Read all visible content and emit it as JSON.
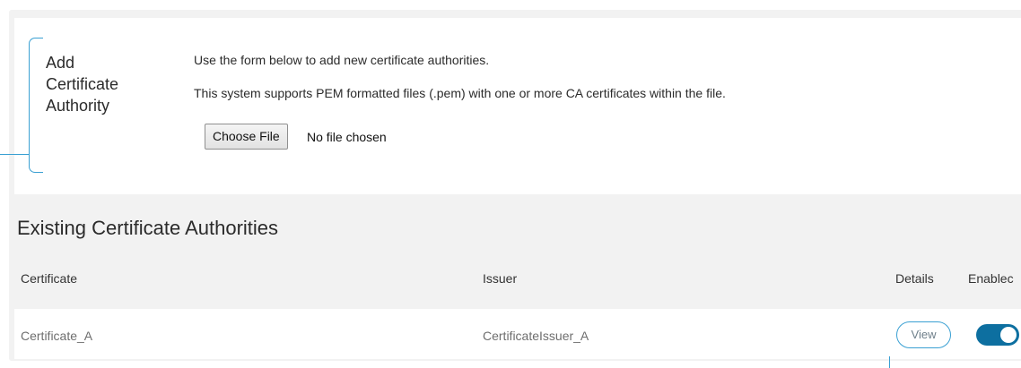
{
  "add_section": {
    "title_lines": [
      "Add",
      "Certificate",
      "Authority"
    ],
    "description": "Use the form below to add new certificate authorities.",
    "support_note": "This system supports PEM formatted files (.pem) with one or more CA certificates within the file.",
    "choose_file_label": "Choose File",
    "file_status": "No file chosen"
  },
  "existing_section": {
    "title": "Existing Certificate Authorities",
    "columns": {
      "certificate": "Certificate",
      "issuer": "Issuer",
      "details": "Details",
      "enabled": "Enablec"
    },
    "rows": [
      {
        "certificate": "Certificate_A",
        "issuer": "CertificateIssuer_A",
        "details_label": "View",
        "enabled": true
      }
    ]
  },
  "colors": {
    "accent": "#3aa0d3",
    "toggle_on": "#0d6fa0",
    "panel_bg": "#f2f2f2"
  }
}
